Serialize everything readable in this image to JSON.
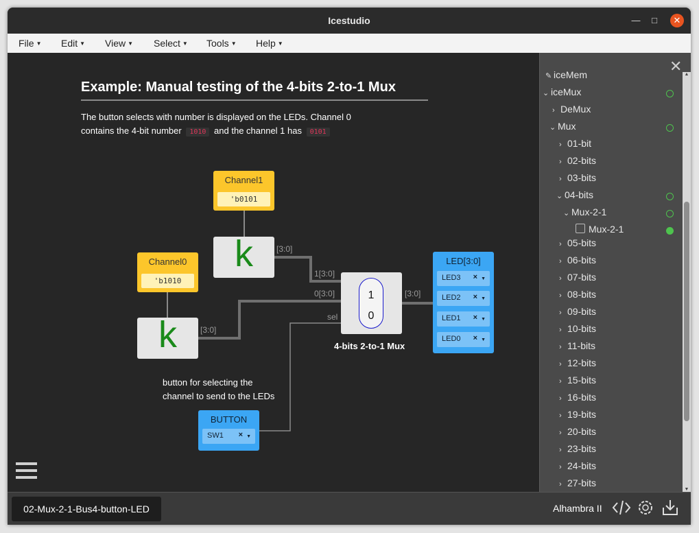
{
  "window": {
    "title": "Icestudio"
  },
  "menubar": [
    "File",
    "Edit",
    "View",
    "Select",
    "Tools",
    "Help"
  ],
  "canvas": {
    "comment_title": "Example: Manual testing of the 4-bits 2-to-1 Mux",
    "comment_line1": "The button selects with number is displayed on the LEDs. Channel 0",
    "comment_line2a": "contains the 4-bit number",
    "comment_code1": "1010",
    "comment_line2b": "and the channel 1 has",
    "comment_code2": "0101",
    "channel1": {
      "label": "Channel1",
      "value": "'b0101"
    },
    "channel0": {
      "label": "Channel0",
      "value": "'b1010"
    },
    "k_symbol": "k",
    "wire_labels": {
      "k1_out": "[3:0]",
      "k0_out": "[3:0]",
      "mux_in1": "1[3:0]",
      "mux_in0": "0[3:0]",
      "mux_sel": "sel",
      "mux_out": "[3:0]"
    },
    "mux": {
      "top": "1",
      "bottom": "0",
      "caption": "4-bits 2-to-1 Mux"
    },
    "led_block": {
      "label": "LED[3:0]",
      "pins": [
        "LED3",
        "LED2",
        "LED1",
        "LED0"
      ]
    },
    "button_block": {
      "label": "BUTTON",
      "pins": [
        "SW1"
      ]
    },
    "button_comment_1": "button for selecting the",
    "button_comment_2": "channel to send to the LEDs"
  },
  "sidebar": {
    "items": [
      {
        "label": "iceMem",
        "status": "none"
      },
      {
        "label": "iceMux",
        "status": "open"
      },
      {
        "label": "DeMux",
        "status": "none"
      },
      {
        "label": "Mux",
        "status": "open"
      },
      {
        "label": "01-bit",
        "status": "none"
      },
      {
        "label": "02-bits",
        "status": "none"
      },
      {
        "label": "03-bits",
        "status": "none"
      },
      {
        "label": "04-bits",
        "status": "open"
      },
      {
        "label": "Mux-2-1",
        "status": "open"
      },
      {
        "label": "Mux-2-1",
        "status": "filled"
      },
      {
        "label": "05-bits",
        "status": "none"
      },
      {
        "label": "06-bits",
        "status": "none"
      },
      {
        "label": "07-bits",
        "status": "none"
      },
      {
        "label": "08-bits",
        "status": "none"
      },
      {
        "label": "09-bits",
        "status": "none"
      },
      {
        "label": "10-bits",
        "status": "none"
      },
      {
        "label": "11-bits",
        "status": "none"
      },
      {
        "label": "12-bits",
        "status": "none"
      },
      {
        "label": "15-bits",
        "status": "none"
      },
      {
        "label": "16-bits",
        "status": "none"
      },
      {
        "label": "19-bits",
        "status": "none"
      },
      {
        "label": "20-bits",
        "status": "none"
      },
      {
        "label": "23-bits",
        "status": "none"
      },
      {
        "label": "24-bits",
        "status": "none"
      },
      {
        "label": "27-bits",
        "status": "none"
      }
    ]
  },
  "footer": {
    "file_tab": "02-Mux-2-1-Bus4-button-LED",
    "board": "Alhambra II"
  },
  "icons": [
    "minimize-icon",
    "maximize-icon",
    "close-icon",
    "menu-icon",
    "code-icon",
    "settings-icon",
    "download-icon"
  ],
  "colors": {
    "constant_block": "#fcc62b",
    "io_block": "#3ba6f4",
    "status_ok": "#4ec34e",
    "accent_close": "#e95420"
  }
}
